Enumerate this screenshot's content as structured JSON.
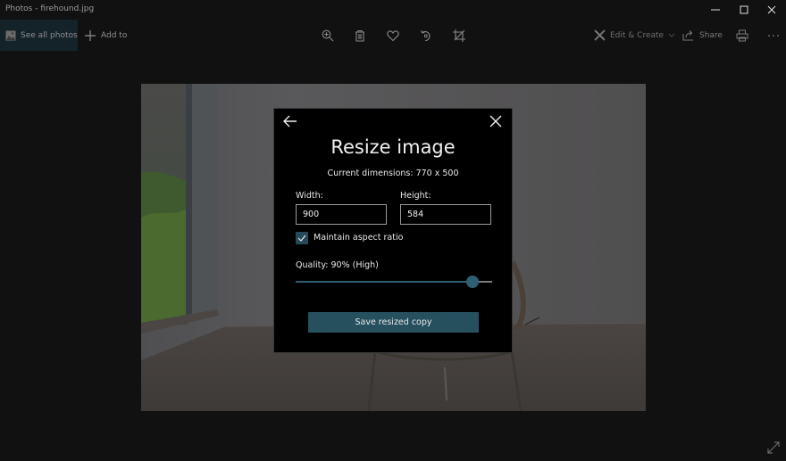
{
  "window": {
    "title": "Photos - firehound.jpg",
    "controls": [
      "minimize",
      "maximize",
      "close"
    ]
  },
  "toolbar": {
    "see_all_photos": "See all photos",
    "add_to": "Add to",
    "center_tools": [
      {
        "name": "zoom-in",
        "icon": "zoom-in-icon"
      },
      {
        "name": "delete",
        "icon": "trash-icon"
      },
      {
        "name": "favorite",
        "icon": "heart-icon"
      },
      {
        "name": "rotate",
        "icon": "rotate-icon"
      },
      {
        "name": "crop",
        "icon": "crop-icon"
      }
    ],
    "edit_create": "Edit & Create",
    "share": "Share",
    "print_icon": "printer-icon",
    "more_icon": "more-icon"
  },
  "dialog": {
    "title": "Resize image",
    "current_dimensions": "Current dimensions: 770 x 500",
    "width_label": "Width:",
    "width_value": "900",
    "height_label": "Height:",
    "height_value": "584",
    "maintain_aspect_label": "Maintain aspect ratio",
    "maintain_aspect_checked": true,
    "quality_label": "Quality: 90% (High)",
    "quality_percent": 90,
    "save_button": "Save resized copy"
  },
  "colors": {
    "accent": "#2e5f74",
    "button": "#27505f",
    "background": "#111111"
  }
}
